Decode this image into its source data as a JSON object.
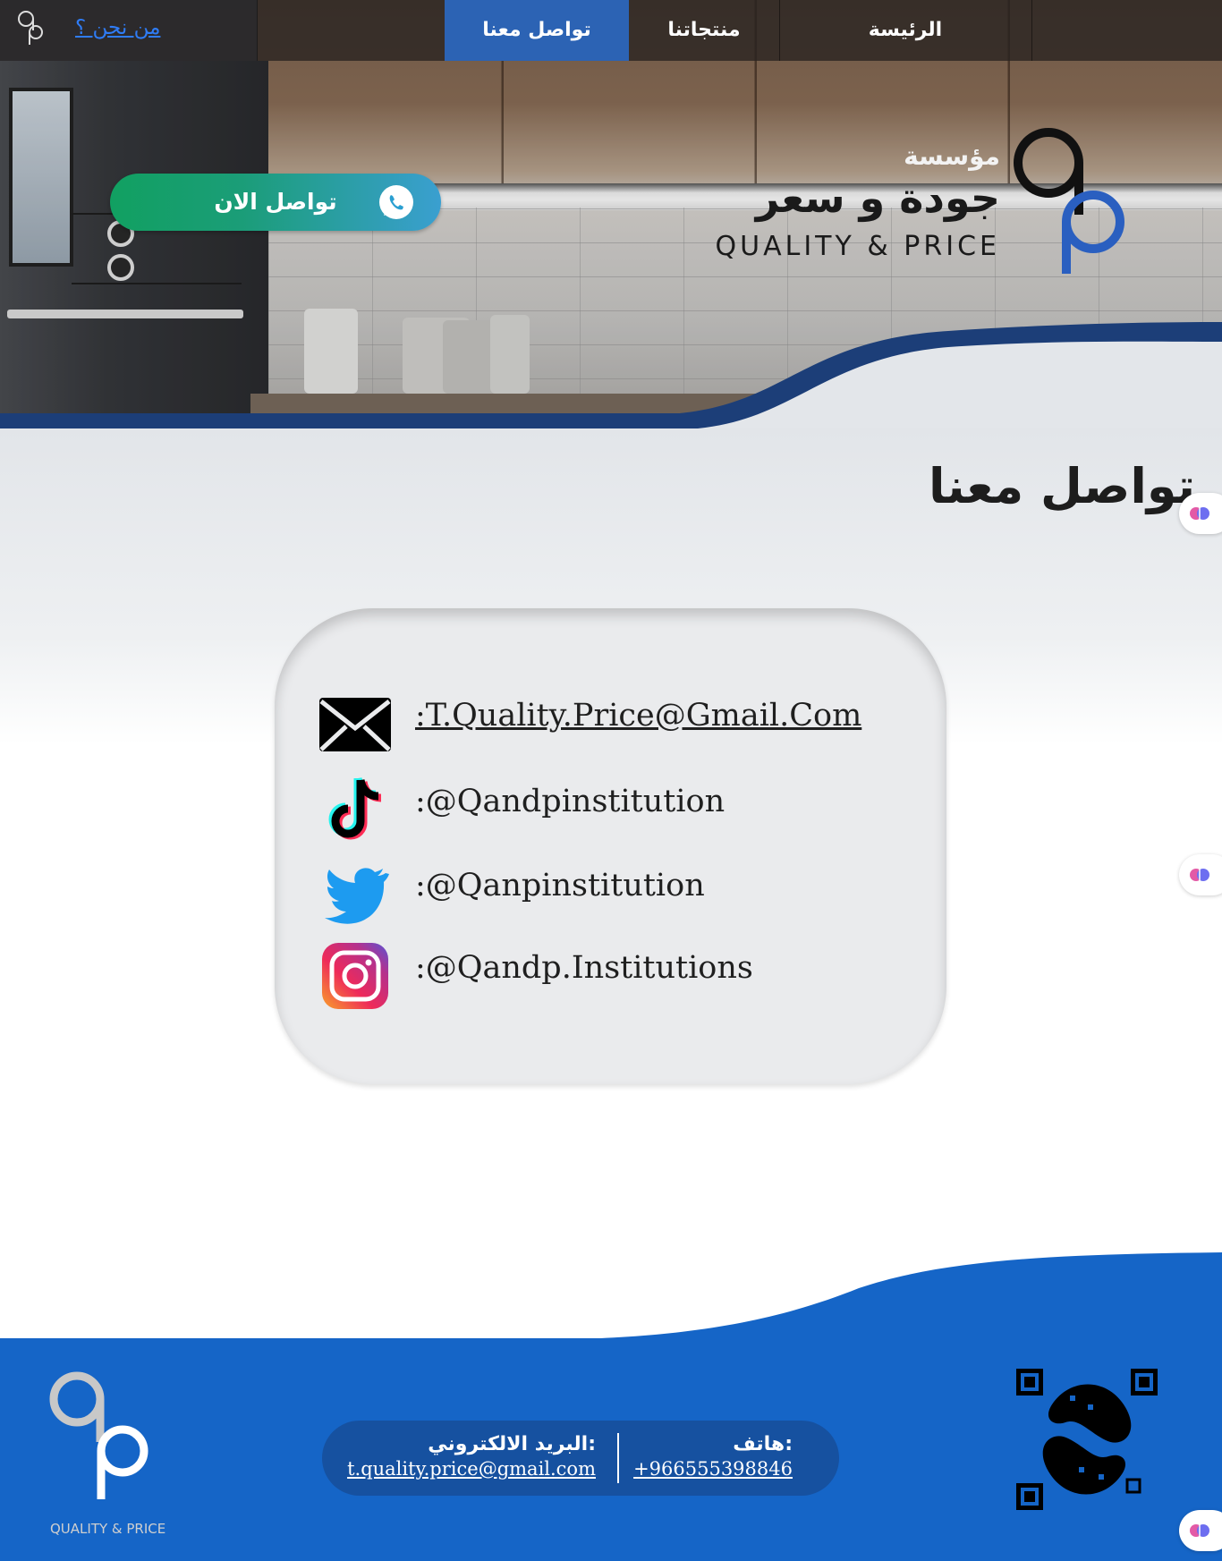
{
  "nav": {
    "about_link": "من نحن ؟",
    "items": [
      {
        "label": "الرئيسة"
      },
      {
        "label": "منتجاتنا"
      },
      {
        "label": "تواصل معنا"
      }
    ],
    "active_index": 2
  },
  "hero": {
    "brand_prefix": "مؤسسة",
    "brand_name_ar": "جودة و سعر",
    "brand_name_en": "QUALITY & PRICE",
    "cta_label": "تواصل الان",
    "cta_icon": "whatsapp-icon"
  },
  "main": {
    "page_title": "تواصل معنا",
    "contacts": [
      {
        "icon": "envelope-icon",
        "text": ":T.Quality.Price@Gmail.Com"
      },
      {
        "icon": "tiktok-icon",
        "text": ":@Qandpinstitution"
      },
      {
        "icon": "twitter-icon",
        "text": ":@Qanpinstitution"
      },
      {
        "icon": "instagram-icon",
        "text": ":@Qandp.Institutions"
      }
    ]
  },
  "footer": {
    "logo_tagline": "QUALITY & PRICE",
    "phone_label": "هاتف:",
    "phone_value": "+966555398846",
    "email_label": "البريد الالكتروني:",
    "email_value": "t.quality.price@gmail.com"
  },
  "colors": {
    "nav_active": "#2c63b4",
    "footer_blue": "#1565c7",
    "pill_blue": "#1651a0",
    "link_blue": "#2f7cf6",
    "cta_green": "#11a061"
  }
}
